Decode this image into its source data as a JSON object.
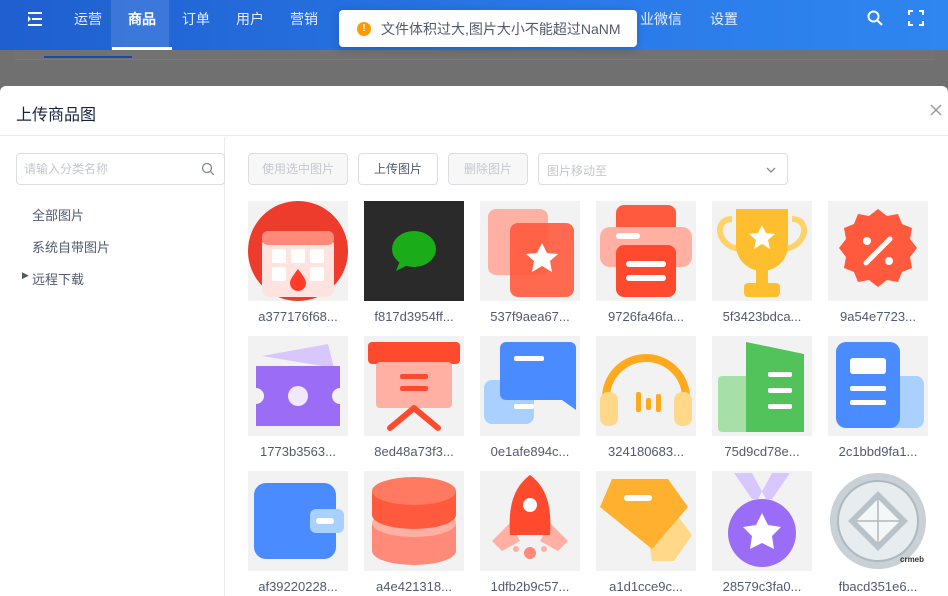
{
  "nav": {
    "items": [
      {
        "label": "运营"
      },
      {
        "label": "商品"
      },
      {
        "label": "订单"
      },
      {
        "label": "用户"
      },
      {
        "label": "营销"
      },
      {
        "label": "业微信"
      },
      {
        "label": "设置"
      }
    ],
    "active": "商品"
  },
  "toast": {
    "text": "文件体积过大,图片大小不能超过NaNM",
    "icon": "warning-icon"
  },
  "modal": {
    "title": "上传商品图",
    "search_placeholder": "请输入分类名称",
    "tree": [
      {
        "label": "全部图片"
      },
      {
        "label": "系统自带图片"
      },
      {
        "label": "远程下载"
      }
    ],
    "toolbar": {
      "use_selected": "使用选中图片",
      "upload": "上传图片",
      "delete": "删除图片",
      "move_placeholder": "图片移动至"
    }
  },
  "images": [
    {
      "caption": "a377176f68...",
      "icon": "calendar-icon"
    },
    {
      "caption": "f817d3954ff...",
      "icon": "chat-bubble-icon"
    },
    {
      "caption": "537f9aea67...",
      "icon": "star-cards-icon"
    },
    {
      "caption": "9726fa46fa...",
      "icon": "printer-icon"
    },
    {
      "caption": "5f3423bdca...",
      "icon": "trophy-icon"
    },
    {
      "caption": "9a54e7723...",
      "icon": "discount-badge-icon"
    },
    {
      "caption": "1773b3563...",
      "icon": "ticket-icon"
    },
    {
      "caption": "8ed48a73f3...",
      "icon": "presentation-board-icon"
    },
    {
      "caption": "0e1afe894c...",
      "icon": "messages-icon"
    },
    {
      "caption": "324180683...",
      "icon": "headphones-icon"
    },
    {
      "caption": "75d9cd78e...",
      "icon": "building-icon"
    },
    {
      "caption": "2c1bbd9fa1...",
      "icon": "document-icon"
    },
    {
      "caption": "af39220228...",
      "icon": "wallet-icon"
    },
    {
      "caption": "a4e421318...",
      "icon": "database-icon"
    },
    {
      "caption": "1dfb2b9c57...",
      "icon": "rocket-icon"
    },
    {
      "caption": "a1d1cce9c...",
      "icon": "tag-icon"
    },
    {
      "caption": "28579c3fa0...",
      "icon": "medal-icon"
    },
    {
      "caption": "fbacd351e6...",
      "icon": "diamond-coin-icon"
    }
  ],
  "watermark": "crmeb",
  "colors": {
    "nav_start": "#1f5fcf",
    "nav_end": "#2f86f0",
    "toast_warning": "#ff9900",
    "icon_red": "#ff5a3d",
    "icon_blue": "#4a8cff",
    "icon_purple": "#9b6cf5",
    "icon_yellow": "#ffbe2e",
    "icon_green": "#52c25a"
  }
}
